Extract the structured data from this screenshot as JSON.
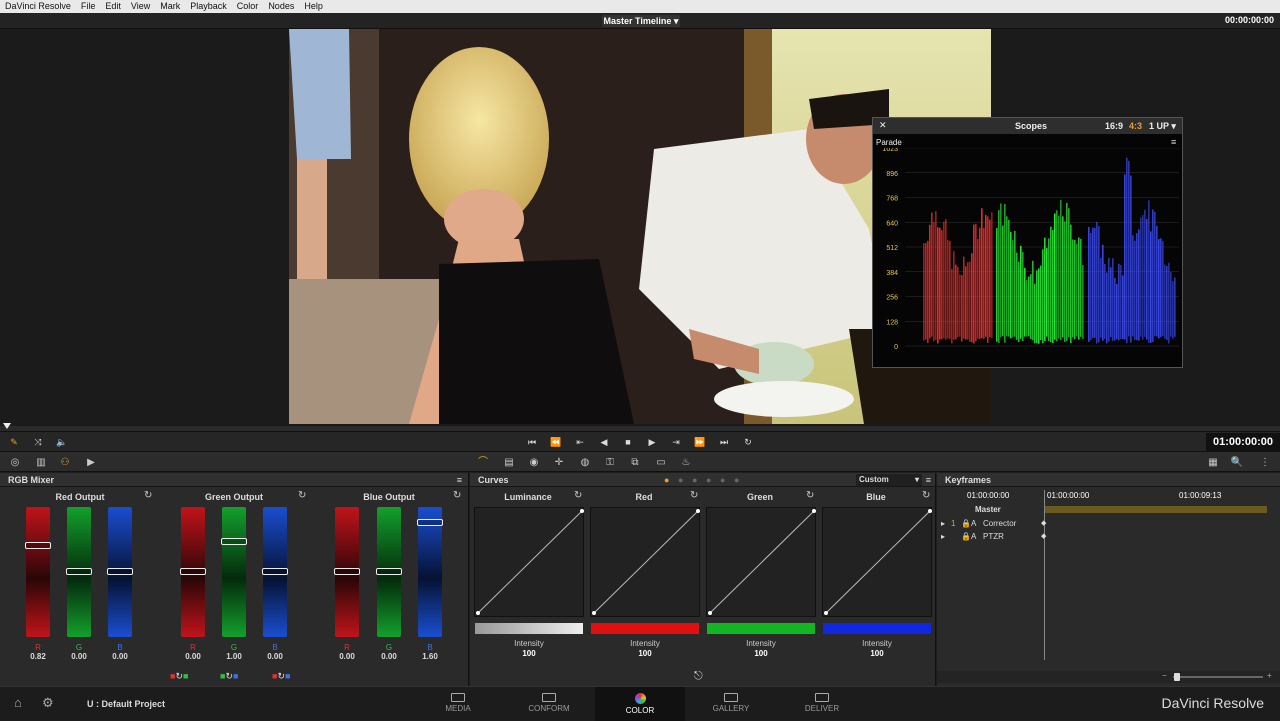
{
  "menu": [
    "DaVinci Resolve",
    "File",
    "Edit",
    "View",
    "Mark",
    "Playback",
    "Color",
    "Nodes",
    "Help"
  ],
  "header": {
    "timeline_title": "Master Timeline",
    "timecode": "00:00:00:00"
  },
  "scopes": {
    "title": "Scopes",
    "aspect_169": "16:9",
    "aspect_43": "4:3",
    "layout": "1 UP",
    "mode": "Parade",
    "scale": [
      "1023",
      "896",
      "768",
      "640",
      "512",
      "384",
      "256",
      "128",
      "0"
    ]
  },
  "transport": {
    "timecode": "01:00:00:00"
  },
  "rgb_mixer": {
    "title": "RGB Mixer",
    "groups": [
      {
        "name": "Red Output",
        "channels": [
          {
            "label": "R",
            "value": "0.82"
          },
          {
            "label": "G",
            "value": "0.00"
          },
          {
            "label": "B",
            "value": "0.00"
          }
        ]
      },
      {
        "name": "Green Output",
        "channels": [
          {
            "label": "R",
            "value": "0.00"
          },
          {
            "label": "G",
            "value": "1.00"
          },
          {
            "label": "B",
            "value": "0.00"
          }
        ]
      },
      {
        "name": "Blue Output",
        "channels": [
          {
            "label": "R",
            "value": "0.00"
          },
          {
            "label": "G",
            "value": "0.00"
          },
          {
            "label": "B",
            "value": "1.60"
          }
        ]
      }
    ]
  },
  "curves": {
    "title": "Curves",
    "preset": "Custom",
    "channels": [
      {
        "name": "Luminance",
        "intensity_label": "Intensity",
        "intensity": "100"
      },
      {
        "name": "Red",
        "intensity_label": "Intensity",
        "intensity": "100"
      },
      {
        "name": "Green",
        "intensity_label": "Intensity",
        "intensity": "100"
      },
      {
        "name": "Blue",
        "intensity_label": "Intensity",
        "intensity": "100"
      }
    ]
  },
  "keyframes": {
    "title": "Keyframes",
    "start_tc": "01:00:00:00",
    "ruler_start": "01:00:00:00",
    "ruler_end": "01:00:09:13",
    "rows": [
      {
        "label": "Master"
      },
      {
        "label": "Corrector"
      },
      {
        "label": "PTZR"
      }
    ]
  },
  "bottom": {
    "project": "U : Default Project",
    "pages": [
      "MEDIA",
      "CONFORM",
      "COLOR",
      "GALLERY",
      "DELIVER"
    ],
    "brand": "DaVinci Resolve"
  }
}
